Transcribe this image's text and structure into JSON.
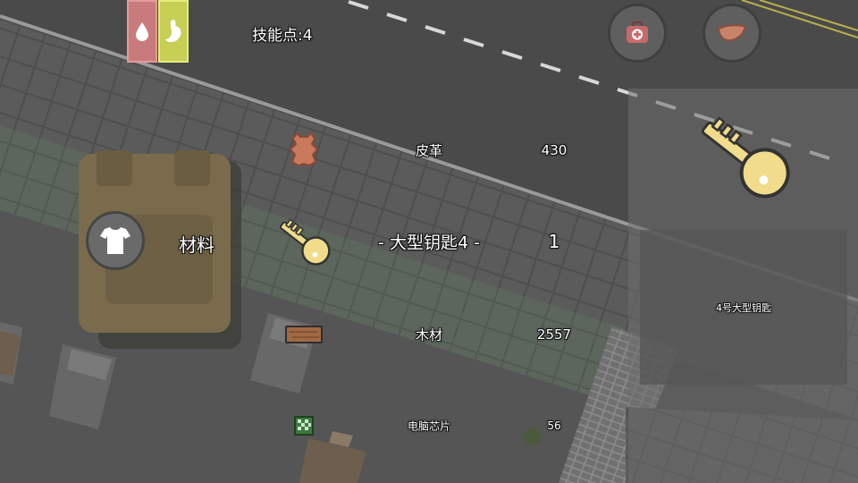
{
  "hud": {
    "skill_points_label": "技能点",
    "skill_points_sep": ":",
    "skill_points_value": "4"
  },
  "buttons": {
    "left": "medkit-icon",
    "right": "meat-icon"
  },
  "inventory": {
    "category_label": "材料",
    "items": [
      {
        "name": "皮革",
        "count": "430",
        "icon": "leather-icon"
      },
      {
        "name": "- 大型钥匙4 -",
        "count": "1",
        "icon": "key-icon",
        "selected": true
      },
      {
        "name": "木材",
        "count": "2557",
        "icon": "wood-plank-icon"
      },
      {
        "name": "电脑芯片",
        "count": "56",
        "icon": "computer-chip-icon"
      }
    ]
  },
  "detail": {
    "icon": "large-key-icon",
    "description": "4号大型钥匙"
  },
  "colors": {
    "water_stat": "#c97b7b",
    "food_stat": "#c7cf55",
    "key_gold": "#f0dc8a",
    "leather": "#c97a5c"
  }
}
